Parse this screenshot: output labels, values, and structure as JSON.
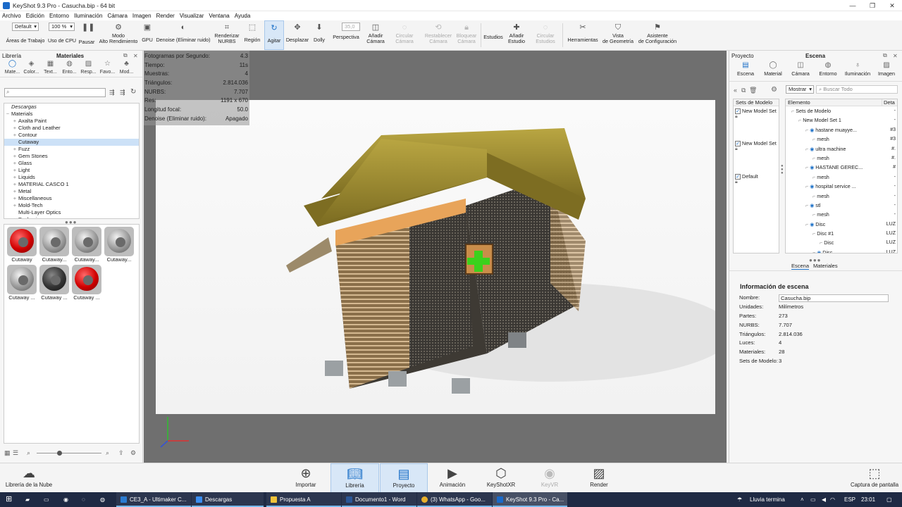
{
  "window": {
    "title": "KeyShot 9.3 Pro  -  Casucha.bip  - 64 bit"
  },
  "menu": [
    "Archivo",
    "Edición",
    "Entorno",
    "Iluminación",
    "Cámara",
    "Imagen",
    "Render",
    "Visualizar",
    "Ventana",
    "Ayuda"
  ],
  "toolbar": {
    "workspace_value": "Default",
    "workspace_label": "Áreas de Trabajo",
    "cpu_value": "100 %",
    "cpu_label": "Uso de CPU",
    "pause": "Pausar",
    "perf_mode": [
      "Modo",
      "Alto Rendimiento"
    ],
    "gpu": "GPU",
    "denoise": "Denoise (Eliminar ruido)",
    "render_nurbs": [
      "Renderizar",
      "NURBS"
    ],
    "region": "Región",
    "tumble": "Agitar",
    "pan": "Desplazar",
    "dolly": "Dolly",
    "fov_value": "35,0",
    "perspective": "Perspectiva",
    "add_camera": [
      "Añadir",
      "Cámara"
    ],
    "orbit_camera": [
      "Circular",
      "Cámara"
    ],
    "reset_camera": [
      "Restablecer",
      "Cámara"
    ],
    "lock_camera": [
      "Bloquear",
      "Cámara"
    ],
    "studios": "Estudios",
    "add_studio": [
      "Añadir",
      "Estudio"
    ],
    "orbit_studios": [
      "Circular",
      "Estudios"
    ],
    "tools": "Herramientas",
    "geometry_view": [
      "Vista",
      "de Geometría"
    ],
    "config_wizard": [
      "Asistente",
      "de Configuración"
    ]
  },
  "library": {
    "panel_left": "Librería",
    "panel_title": "Materiales",
    "tabs": [
      "Mate...",
      "Color...",
      "Text...",
      "Ento...",
      "Resp...",
      "Favo...",
      "Mod..."
    ],
    "tree": [
      {
        "label": "Descargas",
        "italic": true,
        "indent": 0,
        "pm": ""
      },
      {
        "label": "Materials",
        "indent": 0,
        "pm": "−"
      },
      {
        "label": "Axalta Paint",
        "indent": 1,
        "pm": "+"
      },
      {
        "label": "Cloth and Leather",
        "indent": 1,
        "pm": "+"
      },
      {
        "label": "Contour",
        "indent": 1,
        "pm": "+"
      },
      {
        "label": "Cutaway",
        "indent": 1,
        "pm": "",
        "selected": true
      },
      {
        "label": "Fuzz",
        "indent": 1,
        "pm": "+"
      },
      {
        "label": "Gem Stones",
        "indent": 1,
        "pm": "+"
      },
      {
        "label": "Glass",
        "indent": 1,
        "pm": "+"
      },
      {
        "label": "Light",
        "indent": 1,
        "pm": "+"
      },
      {
        "label": "Liquids",
        "indent": 1,
        "pm": "+"
      },
      {
        "label": "MATERIAL CASCO 1",
        "indent": 1,
        "pm": "+"
      },
      {
        "label": "Metal",
        "indent": 1,
        "pm": "+"
      },
      {
        "label": "Miscellaneous",
        "indent": 1,
        "pm": "+"
      },
      {
        "label": "Mold-Tech",
        "indent": 1,
        "pm": "+"
      },
      {
        "label": "Multi-Layer Optics",
        "indent": 1,
        "pm": ""
      },
      {
        "label": "Packaging",
        "indent": 1,
        "pm": "+"
      }
    ],
    "thumbs": [
      {
        "label": "Cutaway",
        "style": "red"
      },
      {
        "label": "Cutaway...",
        "style": "grey"
      },
      {
        "label": "Cutaway...",
        "style": "grey"
      },
      {
        "label": "Cutaway...",
        "style": "grey"
      },
      {
        "label": "Cutaway ...",
        "style": "grey"
      },
      {
        "label": "Cutaway ...",
        "style": "dark"
      },
      {
        "label": "Cutaway ...",
        "style": "red"
      }
    ]
  },
  "hud": [
    {
      "k": "Fotogramas por Segundo:",
      "v": "4.3"
    },
    {
      "k": "Tiempo:",
      "v": "11s"
    },
    {
      "k": "Muestras:",
      "v": "4"
    },
    {
      "k": "Triángulos:",
      "v": "2.814.036"
    },
    {
      "k": "NURBS:",
      "v": "7.707"
    },
    {
      "k": "Res:",
      "v": "1191 x 670"
    },
    {
      "k": "Longitud focal:",
      "v": "50.0"
    },
    {
      "k": "Denoise (Eliminar ruido):",
      "v": "Apagado"
    }
  ],
  "project": {
    "panel_left": "Proyecto",
    "panel_title": "Escena",
    "tabs": [
      "Escena",
      "Material",
      "Cámara",
      "Entorno",
      "Iluminación",
      "Imagen"
    ],
    "show_value": "Mostrar",
    "search_placeholder": "Buscar Todo",
    "sets_header": "Sets de Modelo",
    "sets": [
      "New Model Set",
      "New Model Set",
      "Default"
    ],
    "elem_header": "Elemento",
    "detail_header": "Deta",
    "elements": [
      {
        "label": "Sets de Modelo",
        "indent": 1,
        "v": "-"
      },
      {
        "label": "New Model Set 1",
        "indent": 2,
        "v": "-"
      },
      {
        "label": "hastane muayye...",
        "indent": 3,
        "v": "#3",
        "eye": true
      },
      {
        "label": "mesh",
        "indent": 4,
        "v": "#3"
      },
      {
        "label": "ultra machine",
        "indent": 3,
        "v": "#.",
        "eye": true
      },
      {
        "label": "mesh",
        "indent": 4,
        "v": "#."
      },
      {
        "label": "HASTANE GEREC...",
        "indent": 3,
        "v": "#",
        "eye": true
      },
      {
        "label": "mesh",
        "indent": 4,
        "v": "-"
      },
      {
        "label": "hospital service ...",
        "indent": 3,
        "v": "-",
        "eye": true
      },
      {
        "label": "mesh",
        "indent": 4,
        "v": "-"
      },
      {
        "label": "stl",
        "indent": 3,
        "v": "-",
        "eye": true
      },
      {
        "label": "mesh",
        "indent": 4,
        "v": "-"
      },
      {
        "label": "Disc",
        "indent": 3,
        "v": "LUZ",
        "eye": true
      },
      {
        "label": "Disc #1",
        "indent": 4,
        "v": "LUZ"
      },
      {
        "label": "Disc",
        "indent": 5,
        "v": "LUZ"
      },
      {
        "label": "Disc",
        "indent": 4,
        "v": "LUZ",
        "eye": true
      }
    ],
    "subtabs": [
      "Escena",
      "Materiales"
    ],
    "info_title": "Información de escena",
    "info": [
      {
        "k": "Nombre:",
        "v": "Casucha.bip"
      },
      {
        "k": "Unidades:",
        "v": "Milímetros"
      },
      {
        "k": "Partes:",
        "v": "273"
      },
      {
        "k": "NURBS:",
        "v": "7.707"
      },
      {
        "k": "Triángulos:",
        "v": "2.814.036"
      },
      {
        "k": "Luces:",
        "v": "4"
      },
      {
        "k": "Materiales:",
        "v": "28"
      },
      {
        "k": "Sets de Modelo:",
        "v": "3"
      }
    ]
  },
  "bottom": {
    "cloud": "Librería de la Nube",
    "import": "Importar",
    "library": "Librería",
    "project": "Proyecto",
    "animation": "Animación",
    "keyshotxr": "KeyShotXR",
    "keyvr": "KeyVR",
    "render": "Render",
    "screenshot": "Captura de pantalla"
  },
  "taskbar": {
    "apps": [
      "CE3_A - Ultimaker C...",
      "Descargas",
      "Propuesta A",
      "Documento1 - Word",
      "(3) WhatsApp - Goo...",
      "KeyShot 9.3 Pro - Ca..."
    ],
    "weather": "Lluvia termina",
    "lang": "ESP",
    "time": "23:01"
  },
  "colors": {
    "accent": "#1a6fc7",
    "selection": "#cce1f7",
    "viewport": "#6f6f6f",
    "taskbar": "#1f2a44"
  }
}
